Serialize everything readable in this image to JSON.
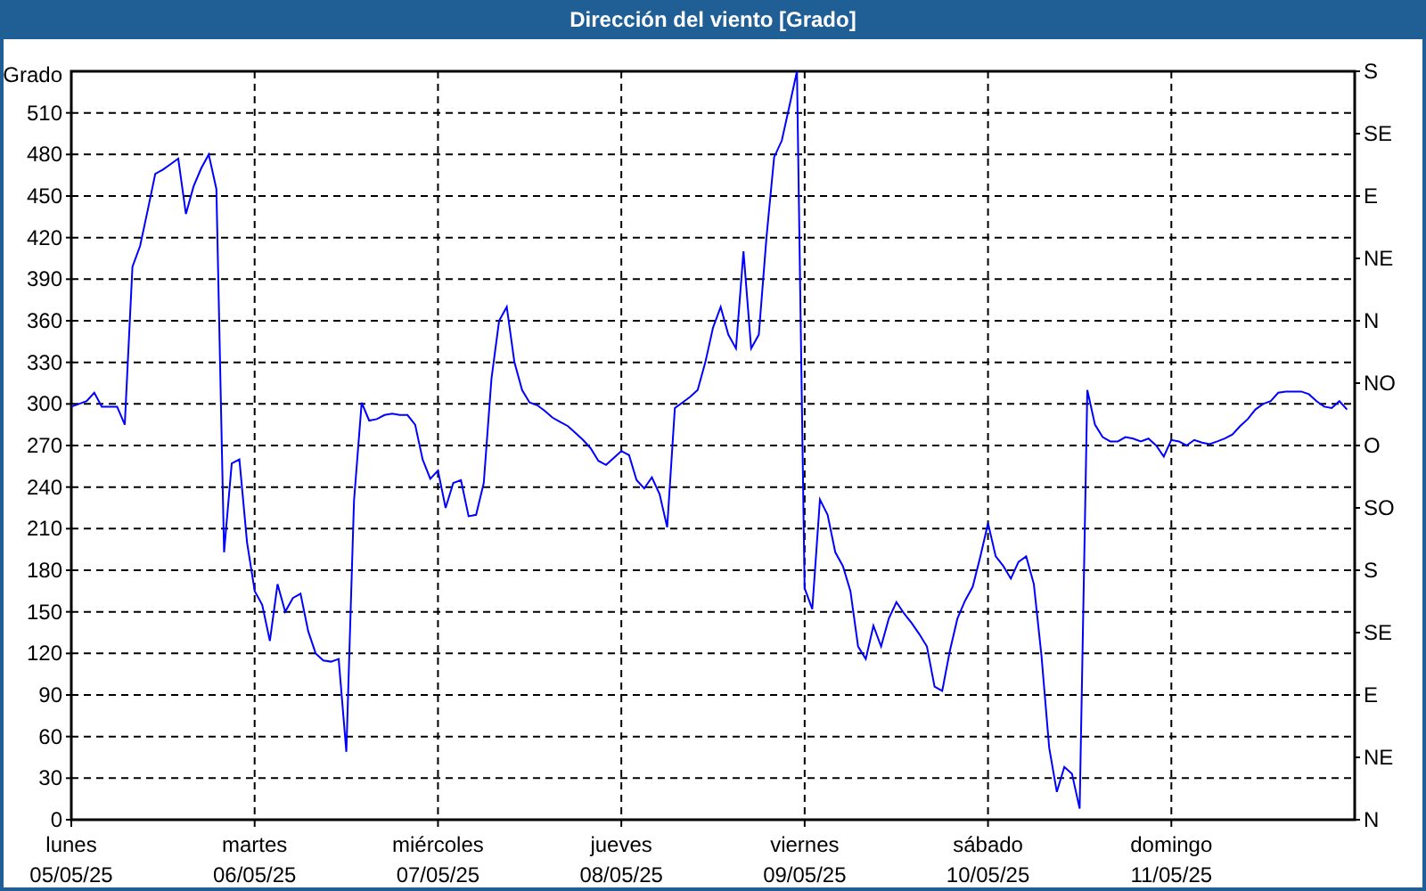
{
  "window": {
    "title": "Dirección del viento [Grado]"
  },
  "chart_data": {
    "type": "line",
    "grid": true,
    "ylabel": "Grado",
    "ylim": [
      0,
      540
    ],
    "yticks": [
      0,
      30,
      60,
      90,
      120,
      150,
      180,
      210,
      240,
      270,
      300,
      330,
      360,
      390,
      420,
      450,
      480,
      510
    ],
    "categories": [
      "lunes 05/05/25",
      null,
      null,
      null,
      null,
      null,
      null,
      null,
      null,
      null,
      null,
      null,
      null,
      null,
      null,
      null,
      null,
      null,
      null,
      null,
      null,
      null,
      null,
      null,
      "martes 06/05/25",
      null,
      null,
      null,
      null,
      null,
      null,
      null,
      null,
      null,
      null,
      null,
      null,
      null,
      null,
      null,
      null,
      null,
      null,
      null,
      null,
      null,
      null,
      null,
      "miércoles 07/05/25",
      null,
      null,
      null,
      null,
      null,
      null,
      null,
      null,
      null,
      null,
      null,
      null,
      null,
      null,
      null,
      null,
      null,
      null,
      null,
      null,
      null,
      null,
      null,
      "jueves 08/05/25",
      null,
      null,
      null,
      null,
      null,
      null,
      null,
      null,
      null,
      null,
      null,
      null,
      null,
      null,
      null,
      null,
      null,
      null,
      null,
      null,
      null,
      null,
      null,
      "viernes 09/05/25",
      null,
      null,
      null,
      null,
      null,
      null,
      null,
      null,
      null,
      null,
      null,
      null,
      null,
      null,
      null,
      null,
      null,
      null,
      null,
      null,
      null,
      null,
      null,
      "sábado 10/05/25",
      null,
      null,
      null,
      null,
      null,
      null,
      null,
      null,
      null,
      null,
      null,
      null,
      null,
      null,
      null,
      null,
      null,
      null,
      null,
      null,
      null,
      null,
      null,
      "domingo 11/05/25",
      null,
      null,
      null,
      null,
      null,
      null,
      null,
      null,
      null,
      null,
      null,
      null,
      null,
      null,
      null,
      null,
      null,
      null,
      null,
      null,
      null,
      null,
      null
    ],
    "series": [
      {
        "color": "#0000ff",
        "values": [
          298,
          300,
          302,
          308,
          298,
          298,
          298,
          285,
          399,
          414,
          440,
          466,
          469,
          473,
          477,
          437,
          457,
          470,
          480,
          455,
          193,
          257,
          260,
          200,
          165,
          155,
          129,
          170,
          150,
          160,
          163,
          136,
          120,
          115,
          114,
          116,
          49,
          230,
          301,
          288,
          289,
          292,
          293,
          292,
          292,
          285,
          260,
          246,
          252,
          225,
          243,
          245,
          219,
          220,
          243,
          318,
          360,
          370,
          330,
          310,
          301,
          299,
          295,
          290,
          287,
          284,
          279,
          274,
          268,
          259,
          256,
          261,
          266,
          263,
          245,
          239,
          247,
          235,
          211,
          297,
          301,
          305,
          310,
          330,
          355,
          370,
          350,
          340,
          410,
          340,
          350,
          420,
          478,
          490,
          515,
          540,
          167,
          152,
          231,
          220,
          193,
          183,
          165,
          125,
          116,
          140,
          125,
          145,
          157,
          149,
          142,
          134,
          125,
          96,
          93,
          122,
          145,
          158,
          168,
          190,
          214,
          190,
          183,
          174,
          186,
          190,
          170,
          118,
          52,
          20,
          38,
          33,
          8,
          310,
          285,
          276,
          273,
          273,
          276,
          275,
          273,
          275,
          270,
          262,
          274,
          273,
          270,
          274,
          272,
          271,
          273,
          275,
          278,
          284,
          289,
          296,
          300,
          302,
          308,
          309,
          309,
          309,
          307,
          302,
          298,
          297,
          302,
          296
        ]
      }
    ]
  },
  "right_axis_labels": [
    "S",
    "SE",
    "E",
    "NE",
    "N",
    "NO",
    "O",
    "SO",
    "S",
    "SE",
    "E",
    "NE",
    "N"
  ]
}
